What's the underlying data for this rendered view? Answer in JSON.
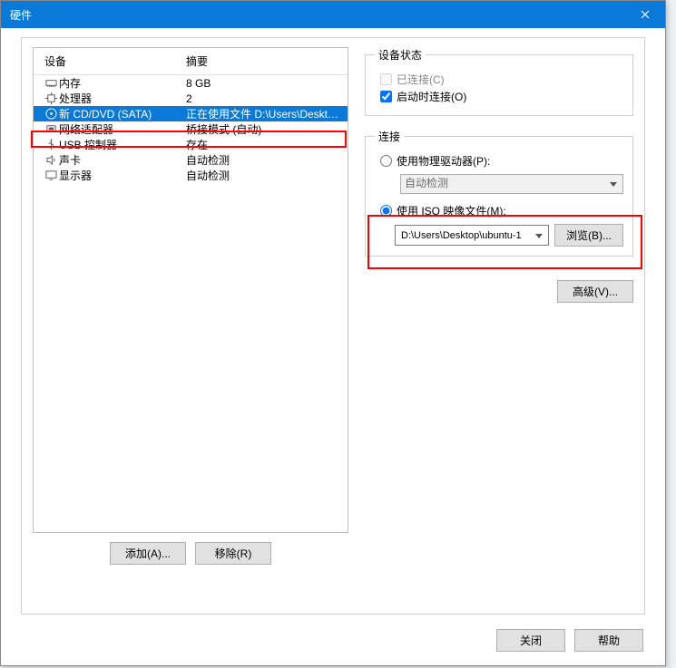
{
  "window": {
    "title": "硬件"
  },
  "devices": {
    "header_device": "设备",
    "header_summary": "摘要",
    "rows": [
      {
        "name": "内存",
        "summary": "8 GB",
        "icon": "memory"
      },
      {
        "name": "处理器",
        "summary": "2",
        "icon": "cpu"
      },
      {
        "name": "新 CD/DVD (SATA)",
        "summary": "正在使用文件 D:\\Users\\Deskto...",
        "icon": "cd",
        "selected": true
      },
      {
        "name": "网络适配器",
        "summary": "桥接模式 (自动)",
        "icon": "network"
      },
      {
        "name": "USB 控制器",
        "summary": "存在",
        "icon": "usb"
      },
      {
        "name": "声卡",
        "summary": "自动检测",
        "icon": "sound"
      },
      {
        "name": "显示器",
        "summary": "自动检测",
        "icon": "display"
      }
    ]
  },
  "buttons": {
    "add": "添加(A)...",
    "remove": "移除(R)",
    "browse": "浏览(B)...",
    "advanced": "高级(V)...",
    "close": "关闭",
    "help": "帮助"
  },
  "device_status": {
    "legend": "设备状态",
    "connected": "已连接(C)",
    "connect_on_start": "启动时连接(O)"
  },
  "connection": {
    "legend": "连接",
    "use_physical": "使用物理驱动器(P):",
    "auto_detect": "自动检测",
    "use_iso": "使用 ISO 映像文件(M):",
    "iso_path": "D:\\Users\\Desktop\\ubuntu-1"
  }
}
